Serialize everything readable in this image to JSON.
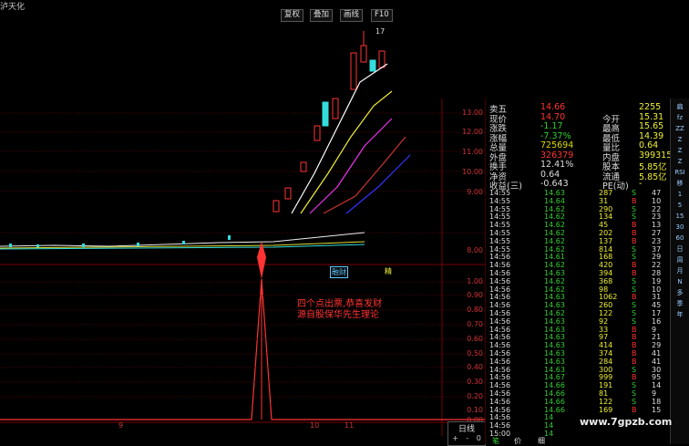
{
  "window": {
    "title": "泸天化"
  },
  "chart_toolbar": {
    "buttons": [
      "复权",
      "叠加",
      "画线",
      "F10"
    ]
  },
  "price_axis": [
    "13.00",
    "12.00",
    "11.00",
    "10.00",
    "9.00",
    "8.00"
  ],
  "indicator_axis": [
    "1.00",
    "0.90",
    "0.80",
    "0.70",
    "0.60",
    "0.50",
    "0.40",
    "0.30",
    "0.20",
    "0.10",
    "0.00"
  ],
  "peak_label": "17",
  "tags": [
    "融财",
    "精"
  ],
  "annotation": {
    "line1": "四个点出票,恭喜发财",
    "line2": "源自股保华先生理论"
  },
  "date_axis": [
    "9",
    "10",
    "11"
  ],
  "period_box": {
    "label": "日线",
    "plus": "+",
    "minus": "-",
    "zero": "0"
  },
  "quote": [
    {
      "l": "卖五",
      "v": "14.66",
      "r": "",
      "rv": "2255",
      "vc": "#f33"
    },
    {
      "l": "现价",
      "v": "14.70",
      "r": "今开",
      "rv": "15.31",
      "vc": "#f33"
    },
    {
      "l": "涨跌",
      "v": "-1.17",
      "r": "最高",
      "rv": "15.65",
      "vc": "#3c3"
    },
    {
      "l": "涨幅",
      "v": "-7.37%",
      "r": "最低",
      "rv": "14.39",
      "vc": "#3c3"
    },
    {
      "l": "总量",
      "v": "725694",
      "r": "量比",
      "rv": "0.64",
      "vc": "#dd0"
    },
    {
      "l": "外盘",
      "v": "326379",
      "r": "内盘",
      "rv": "399315",
      "vc": "#f33"
    },
    {
      "l": "换手",
      "v": "12.41%",
      "r": "股本",
      "rv": "5.85亿",
      "vc": "#ddd"
    },
    {
      "l": "净资",
      "v": "0.64",
      "r": "流通",
      "rv": "5.85亿",
      "vc": "#ddd"
    },
    {
      "l": "收益(三)",
      "v": "-0.643",
      "r": "PE(动)",
      "rv": "-",
      "vc": "#ddd"
    }
  ],
  "ticks": [
    [
      "14:55",
      "14.63",
      "287",
      "S",
      "47"
    ],
    [
      "14:55",
      "14.64",
      "31",
      "B",
      "10"
    ],
    [
      "14:55",
      "14.62",
      "290",
      "S",
      "22"
    ],
    [
      "14:55",
      "14.62",
      "134",
      "S",
      "23"
    ],
    [
      "14:55",
      "14.62",
      "45",
      "B",
      "13"
    ],
    [
      "14:55",
      "14.62",
      "202",
      "B",
      "27"
    ],
    [
      "14:55",
      "14.62",
      "137",
      "B",
      "23"
    ],
    [
      "14:55",
      "14.62",
      "814",
      "S",
      "37"
    ],
    [
      "14:56",
      "14.61",
      "168",
      "S",
      "29"
    ],
    [
      "14:56",
      "14.62",
      "420",
      "B",
      "22"
    ],
    [
      "14:56",
      "14.63",
      "394",
      "B",
      "28"
    ],
    [
      "14:56",
      "14.62",
      "368",
      "S",
      "19"
    ],
    [
      "14:56",
      "14.62",
      "98",
      "S",
      "10"
    ],
    [
      "14:56",
      "14.63",
      "1062",
      "B",
      "31"
    ],
    [
      "14:56",
      "14.63",
      "260",
      "S",
      "45"
    ],
    [
      "14:56",
      "14.62",
      "122",
      "S",
      "17"
    ],
    [
      "14:56",
      "14.63",
      "92",
      "S",
      "16"
    ],
    [
      "14:56",
      "14.63",
      "33",
      "B",
      "9"
    ],
    [
      "14:56",
      "14.63",
      "97",
      "B",
      "21"
    ],
    [
      "14:56",
      "14.63",
      "414",
      "B",
      "29"
    ],
    [
      "14:56",
      "14.63",
      "374",
      "B",
      "41"
    ],
    [
      "14:56",
      "14.63",
      "284",
      "B",
      "41"
    ],
    [
      "14:56",
      "14.63",
      "300",
      "S",
      "30"
    ],
    [
      "14:56",
      "14.67",
      "999",
      "B",
      "95"
    ],
    [
      "14:56",
      "14.66",
      "191",
      "S",
      "14"
    ],
    [
      "14:56",
      "14.66",
      "81",
      "S",
      "9"
    ],
    [
      "14:56",
      "14.66",
      "122",
      "S",
      "18"
    ],
    [
      "14:56",
      "14.66",
      "169",
      "B",
      "15"
    ],
    [
      "14:56",
      "14",
      "",
      "",
      " "
    ],
    [
      "14:56",
      "14",
      "",
      "",
      ""
    ],
    [
      "15:00",
      "14",
      "",
      "",
      ""
    ]
  ],
  "side_toolbar": [
    "扁",
    "fz",
    "ZZ",
    "Z",
    "Z",
    "Z",
    "RSI",
    "移",
    "1",
    "5",
    "15",
    "30",
    "60",
    "日",
    "周",
    "月",
    "N",
    "多",
    "季",
    "年"
  ],
  "bottom_tabs": [
    "笔",
    "价",
    "细"
  ],
  "watermark": "www.7gpzb.com"
}
